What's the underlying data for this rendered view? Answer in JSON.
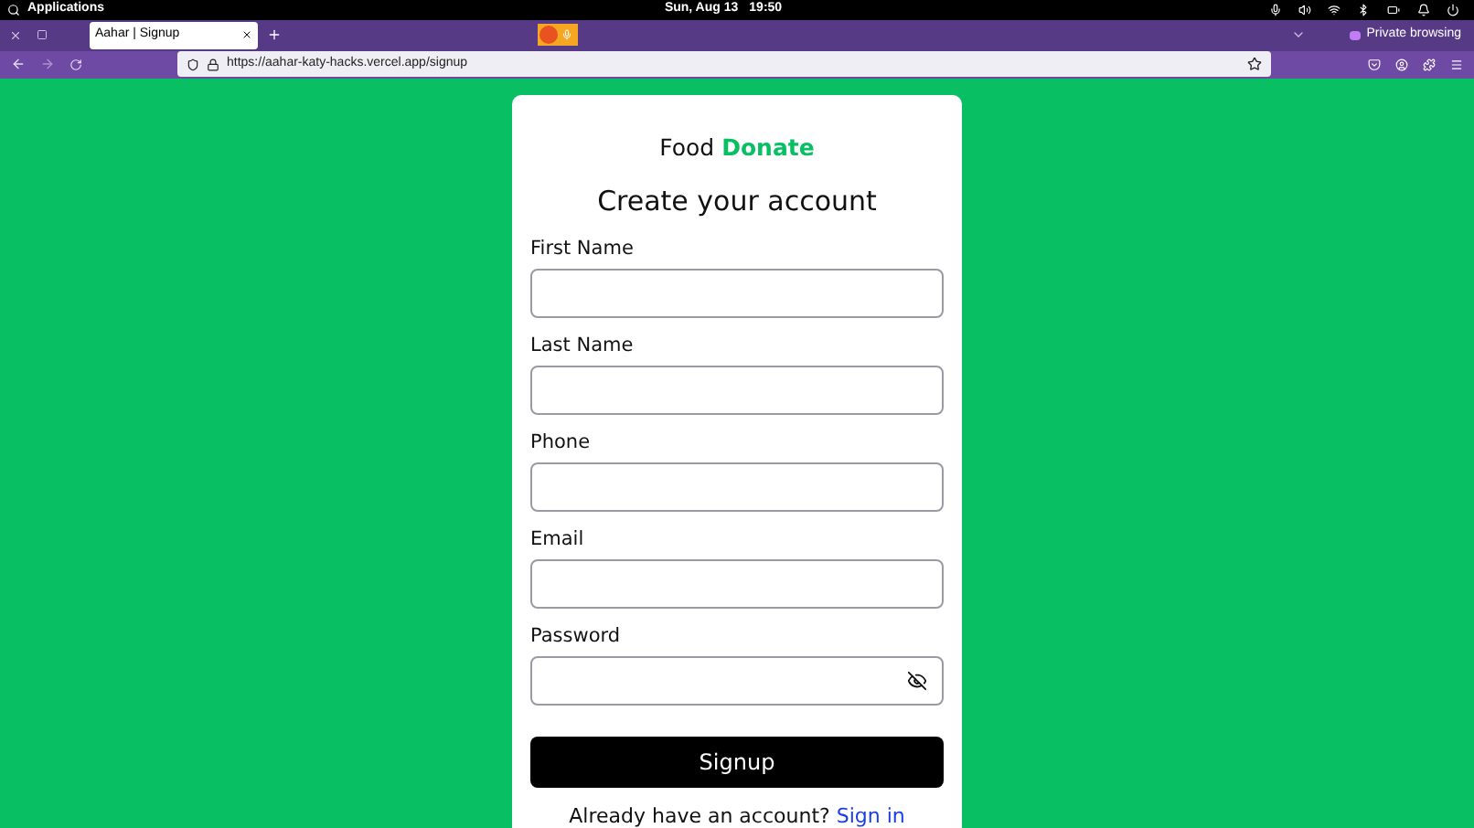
{
  "system_bar": {
    "menu": "Applications",
    "date": "Sun, Aug 13",
    "time": "19:50"
  },
  "tabs": [
    {
      "label": "Aahar | Signup",
      "selected": true
    }
  ],
  "private_label": "Private browsing",
  "address_bar": {
    "value": "https://aahar-katy-hacks.vercel.app/signup"
  },
  "card": {
    "brand": "Food",
    "brand_accent": "Donate",
    "title": "Create your account",
    "fields": [
      {
        "label": "First Name",
        "kind": "text"
      },
      {
        "label": "Last Name",
        "kind": "text"
      },
      {
        "label": "Phone",
        "kind": "text"
      },
      {
        "label": "Email",
        "kind": "text"
      },
      {
        "label": "Password",
        "kind": "password"
      }
    ],
    "submit": "Signup",
    "footer_text": "Already have an account?",
    "footer_link": "Sign in"
  }
}
